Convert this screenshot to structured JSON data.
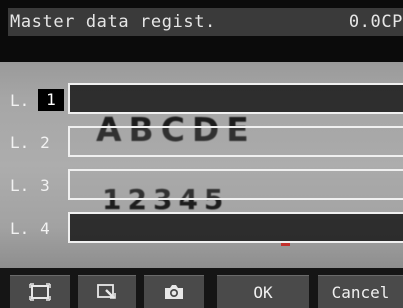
{
  "header": {
    "title": "Master data regist.",
    "value": "0.0CP"
  },
  "image": {
    "text_line_1": "ABCDE",
    "text_line_2": "12345"
  },
  "lines": [
    {
      "prefix": "L.",
      "number": "1",
      "active": true
    },
    {
      "prefix": "L.",
      "number": "2",
      "active": false
    },
    {
      "prefix": "L.",
      "number": "3",
      "active": false
    },
    {
      "prefix": "L.",
      "number": "4",
      "active": false
    }
  ],
  "toolbar": {
    "frame_icon": "frame-icon",
    "zoom_icon": "zoom-region-icon",
    "camera_icon": "camera-icon",
    "ok_label": "OK",
    "cancel_label": "Cancel"
  },
  "colors": {
    "background": "#000000",
    "header": "#3a3a3a",
    "field_border": "#f0f0f0",
    "button": "#4a4a4a",
    "marker": "#c2302c"
  }
}
